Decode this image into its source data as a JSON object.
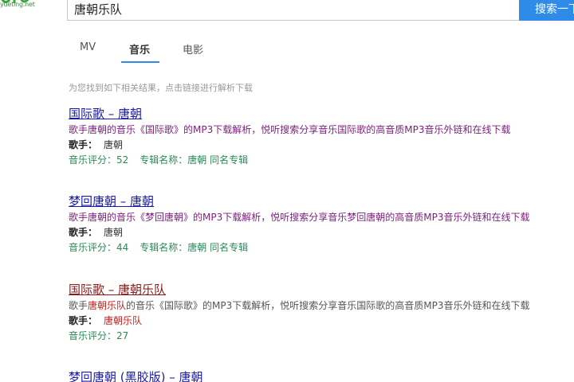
{
  "logo": {
    "text": "yueting.net"
  },
  "search": {
    "query": "唐朝乐队",
    "button_label": "搜索一下"
  },
  "tabs": [
    {
      "label": "MV"
    },
    {
      "label": "音乐"
    },
    {
      "label": "电影"
    }
  ],
  "hint": "为您找到如下相关结果，点击链接进行解析下载",
  "results": [
    {
      "title": "国际歌 – 唐朝",
      "desc_before": "歌手唐朝的音乐《国际歌》的MP3下载解析，悦听搜索分享音乐国际歌的高音质MP3音乐外链和在线下载",
      "singer_label": "歌手：",
      "singer": "唐朝",
      "rating": "音乐评分：52",
      "album": "专辑名称：唐朝 同名专辑"
    },
    {
      "title": "梦回唐朝 – 唐朝",
      "desc_before": "歌手唐朝的音乐《梦回唐朝》的MP3下载解析，悦听搜索分享音乐梦回唐朝的高音质MP3音乐外链和在线下载",
      "singer_label": "歌手：",
      "singer": "唐朝",
      "rating": "音乐评分：44",
      "album": "专辑名称：唐朝 同名专辑"
    },
    {
      "title": "国际歌 – 唐朝乐队",
      "desc_before": "歌手",
      "desc_highlight": "唐朝乐队",
      "desc_after": "的音乐《国际歌》的MP3下载解析，悦听搜索分享音乐国际歌的高音质MP3音乐外链和在线下载",
      "singer_label": "歌手：",
      "singer": "唐朝乐队",
      "rating": "音乐评分：27"
    },
    {
      "title": "梦回唐朝 (黑胶版) – 唐朝"
    }
  ]
}
